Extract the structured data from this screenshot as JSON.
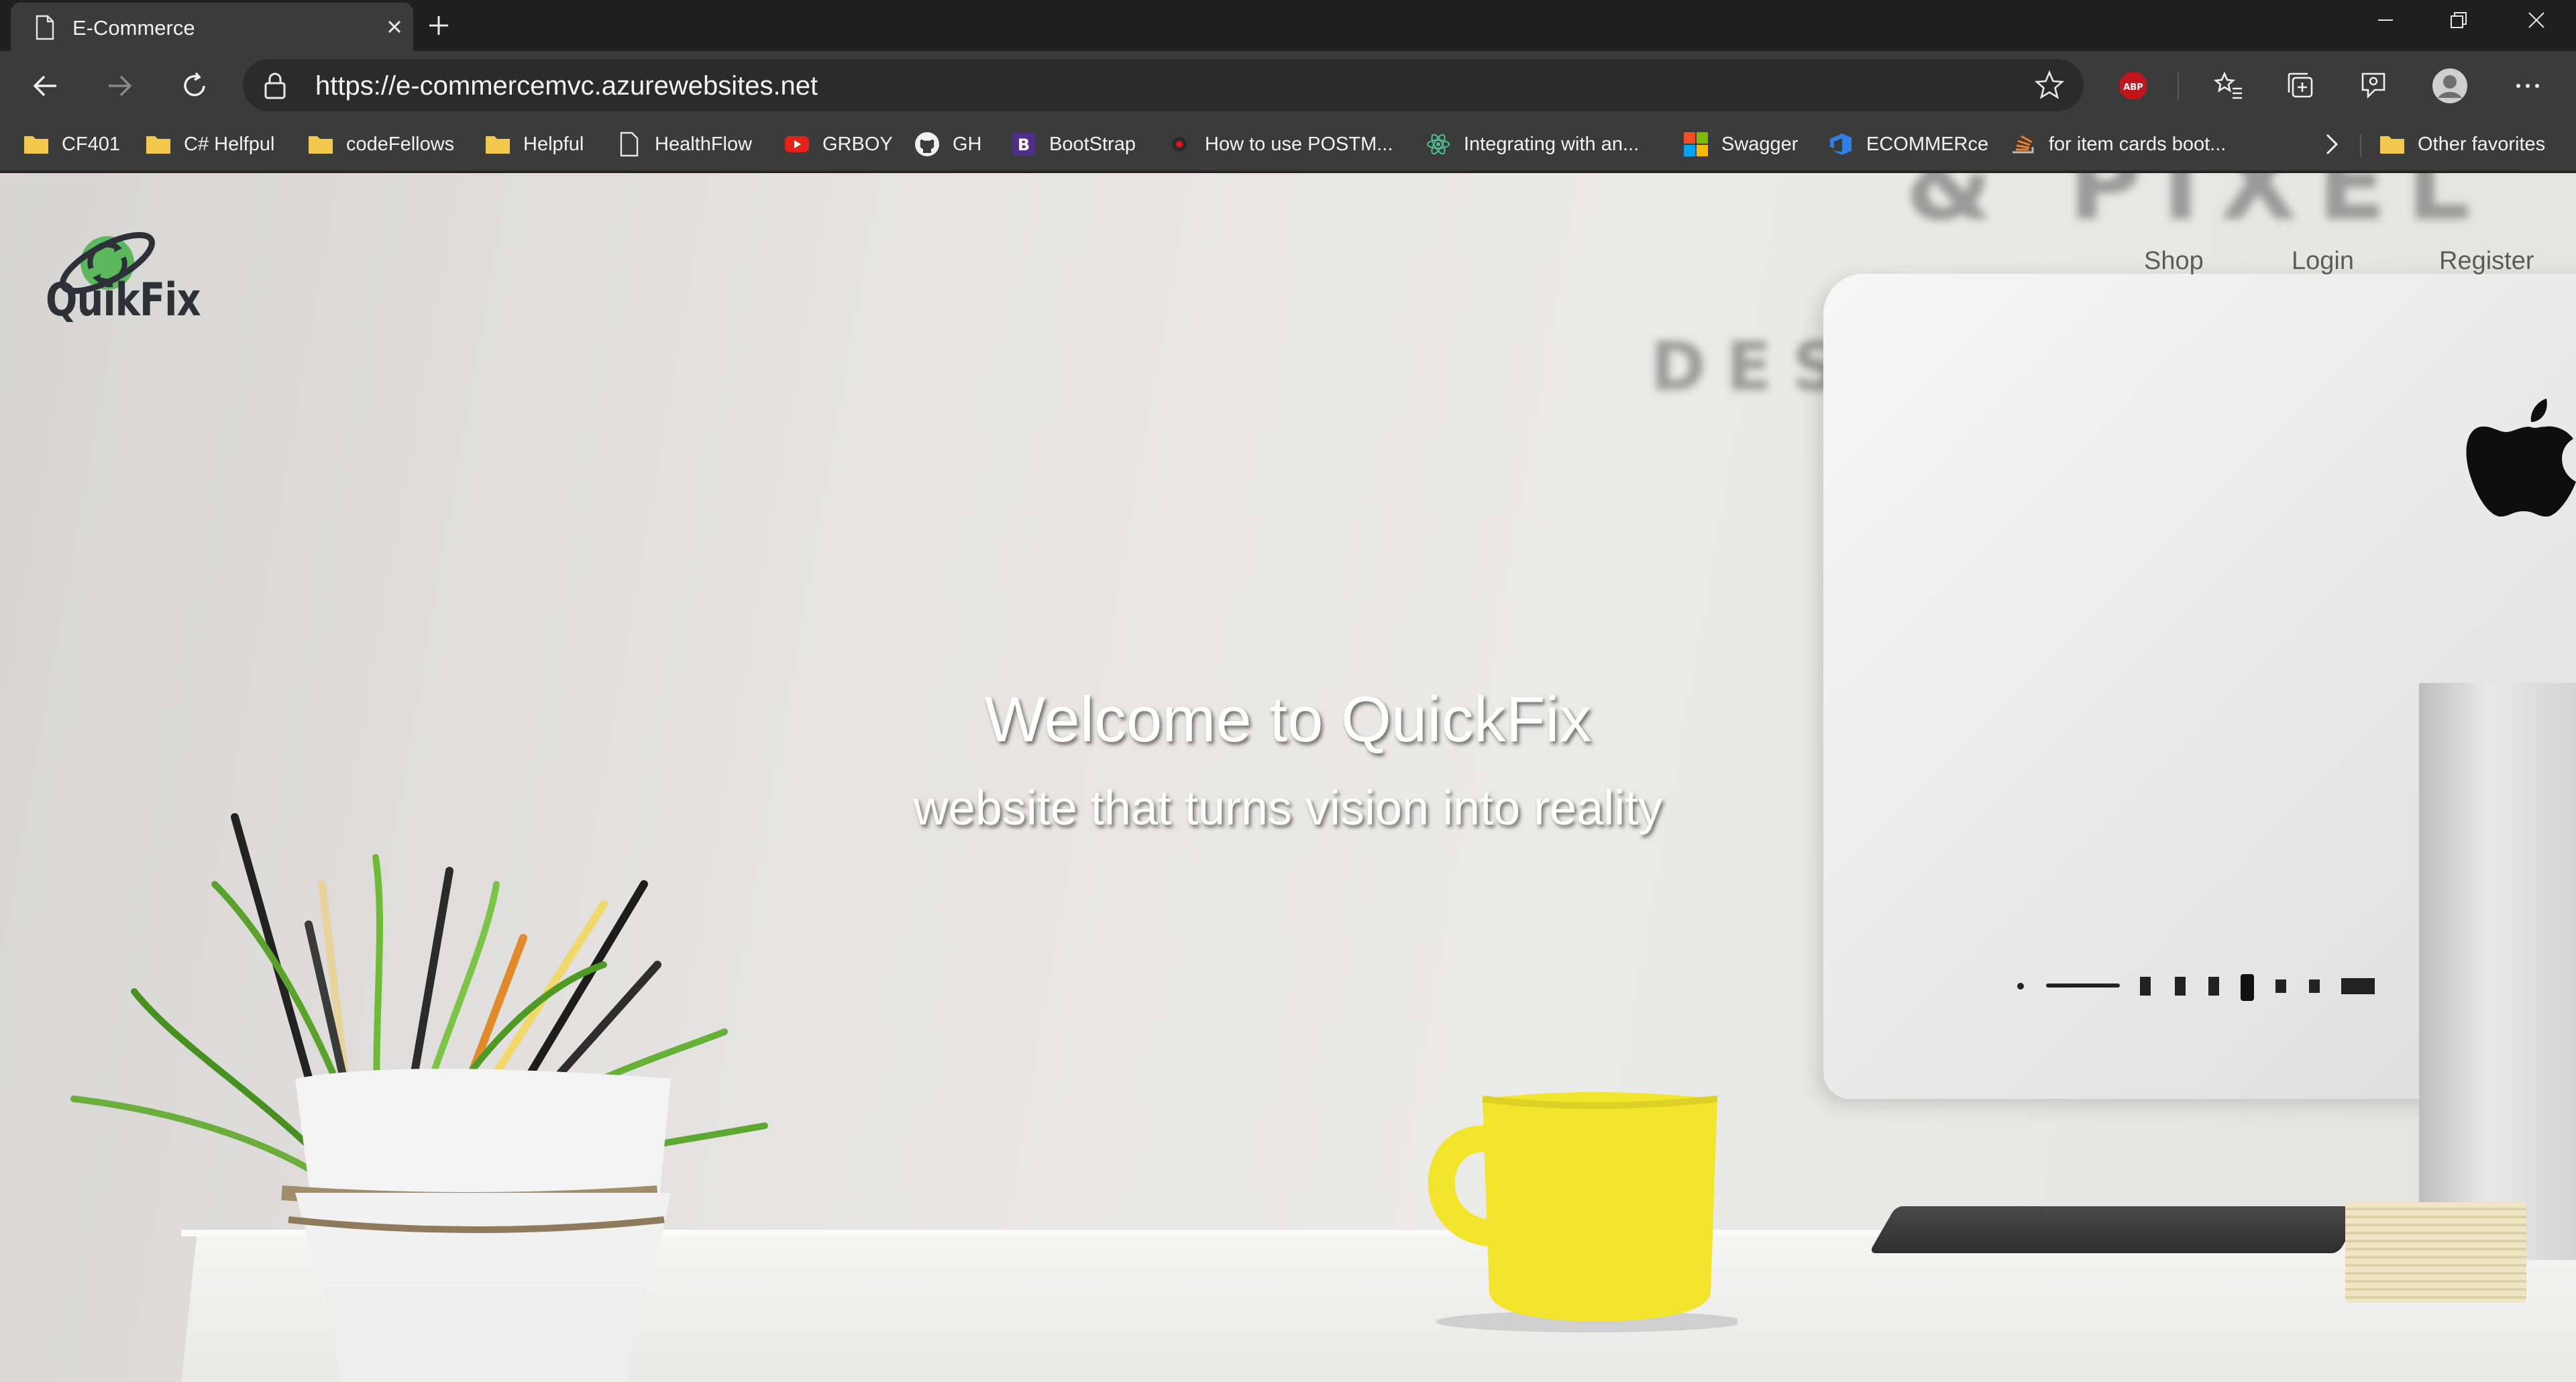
{
  "browser": {
    "tab": {
      "title": "E-Commerce"
    },
    "address": {
      "url": "https://e-commercemvc.azurewebsites.net"
    },
    "toolbar": {
      "abp_label": "ABP"
    },
    "favorites": [
      {
        "label": "CF401",
        "icon": "folder-icon"
      },
      {
        "label": "C# Helfpul",
        "icon": "folder-icon"
      },
      {
        "label": "codeFellows",
        "icon": "folder-icon"
      },
      {
        "label": "Helpful",
        "icon": "folder-icon"
      },
      {
        "label": "HealthFlow",
        "icon": "page-icon"
      },
      {
        "label": "GRBOY",
        "icon": "youtube-icon"
      },
      {
        "label": "GH",
        "icon": "github-icon"
      },
      {
        "label": "BootStrap",
        "icon": "bootstrap-icon"
      },
      {
        "label": "How to use POSTM...",
        "icon": "record-icon"
      },
      {
        "label": "Integrating with an...",
        "icon": "react-icon"
      },
      {
        "label": "Swagger",
        "icon": "microsoft-icon"
      },
      {
        "label": "ECOMMERce",
        "icon": "azure-devops-icon"
      },
      {
        "label": "for item cards boot...",
        "icon": "stackoverflow-icon"
      }
    ],
    "other_favorites": "Other favorites"
  },
  "site": {
    "logo_text": "QuikFix",
    "nav": {
      "shop": "Shop",
      "login": "Login",
      "register": "Register"
    },
    "hero": {
      "title": "Welcome to QuickFix",
      "subtitle": "website that turns vision into reality"
    },
    "wall_text": {
      "top": "& PIXEL",
      "left": "DES"
    }
  },
  "colors": {
    "browser_chrome": "#3b3b3b",
    "titlebar": "#1f1f1f",
    "logo_green": "#5cb85c",
    "mug_yellow": "#f2e52b",
    "abp_red": "#c1151b"
  }
}
